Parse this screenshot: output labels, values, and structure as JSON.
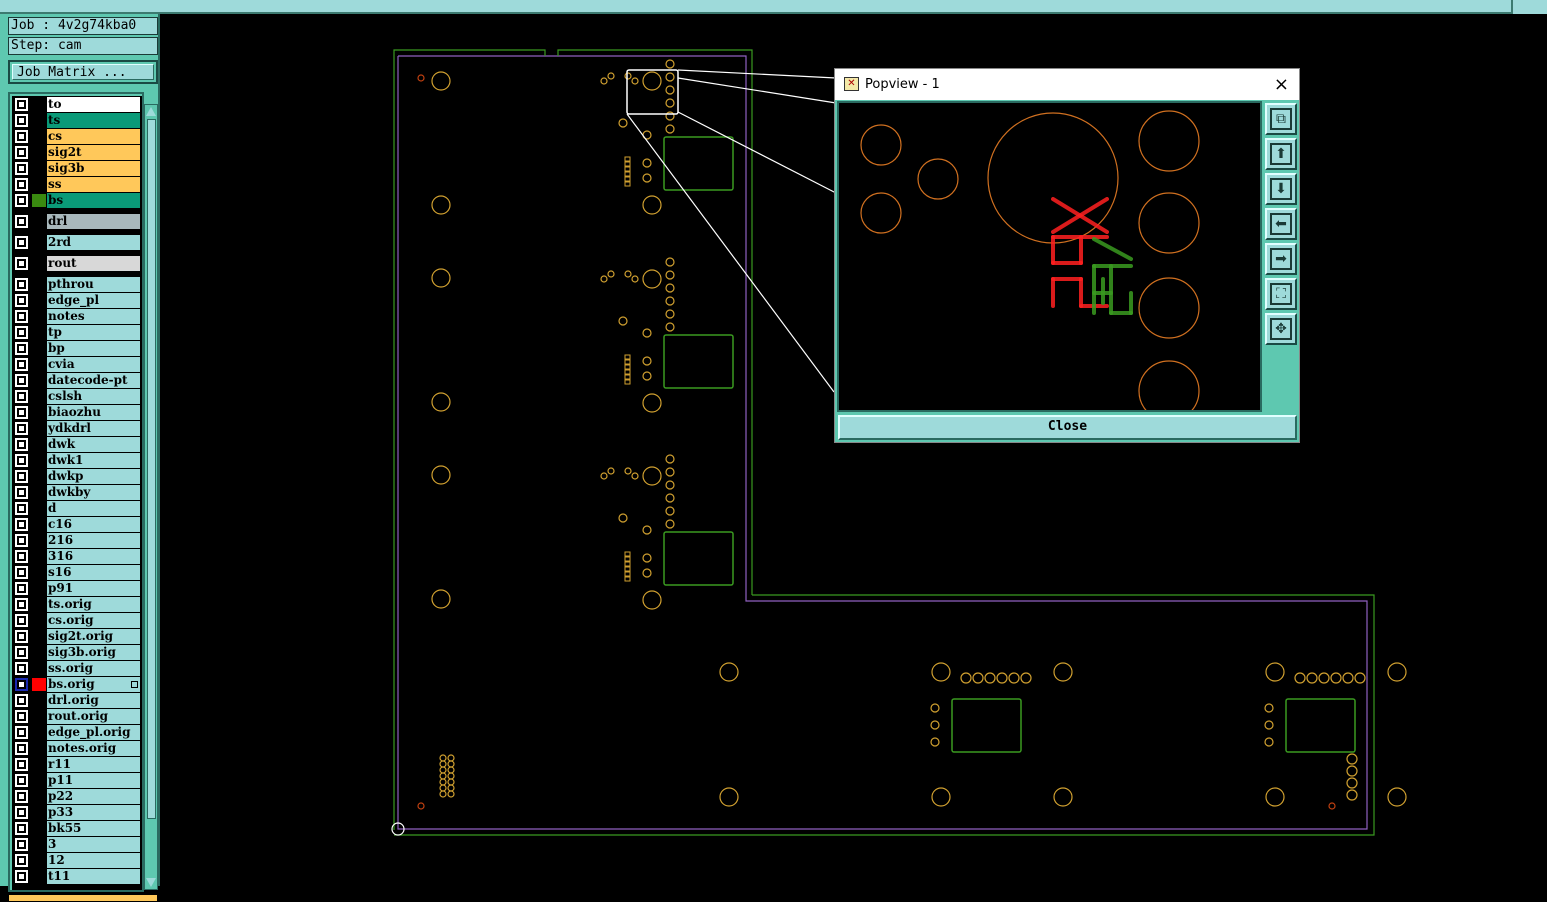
{
  "header": {
    "job_label": "Job : 4v2g74kba0",
    "step_label": "Step: cam",
    "job_matrix_button": "Job Matrix ..."
  },
  "layers": [
    {
      "name": "to",
      "color": "#ffffff"
    },
    {
      "name": "ts",
      "color": "#0a9a78"
    },
    {
      "name": "cs",
      "color": "#ffc85a"
    },
    {
      "name": "sig2t",
      "color": "#ffc85a"
    },
    {
      "name": "sig3b",
      "color": "#ffc85a"
    },
    {
      "name": "ss",
      "color": "#ffc85a"
    },
    {
      "name": "bs",
      "color": "#0a9a78",
      "display_color": "#3a8a10"
    },
    {
      "name": "drl",
      "color": "#a8b8bc"
    },
    {
      "name": "2rd",
      "color": "#9edada"
    },
    {
      "name": "rout",
      "color": "#d8d8d8"
    },
    {
      "name": "pthrou",
      "color": "#9edada"
    },
    {
      "name": "edge_pl",
      "color": "#9edada"
    },
    {
      "name": "notes",
      "color": "#9edada"
    },
    {
      "name": "tp",
      "color": "#9edada"
    },
    {
      "name": "bp",
      "color": "#9edada"
    },
    {
      "name": "cvia",
      "color": "#9edada"
    },
    {
      "name": "datecode-pt",
      "color": "#9edada"
    },
    {
      "name": "cslsh",
      "color": "#9edada"
    },
    {
      "name": "biaozhu",
      "color": "#9edada"
    },
    {
      "name": "ydkdrl",
      "color": "#9edada"
    },
    {
      "name": "dwk",
      "color": "#9edada"
    },
    {
      "name": "dwk1",
      "color": "#9edada"
    },
    {
      "name": "dwkp",
      "color": "#9edada"
    },
    {
      "name": "dwkby",
      "color": "#9edada"
    },
    {
      "name": "d",
      "color": "#9edada"
    },
    {
      "name": "c16",
      "color": "#9edada"
    },
    {
      "name": "216",
      "color": "#9edada"
    },
    {
      "name": "316",
      "color": "#9edada"
    },
    {
      "name": "s16",
      "color": "#9edada"
    },
    {
      "name": "p91",
      "color": "#9edada"
    },
    {
      "name": "ts.orig",
      "color": "#9edada"
    },
    {
      "name": "cs.orig",
      "color": "#9edada"
    },
    {
      "name": "sig2t.orig",
      "color": "#9edada"
    },
    {
      "name": "sig3b.orig",
      "color": "#9edada"
    },
    {
      "name": "ss.orig",
      "color": "#9edada"
    },
    {
      "name": "bs.orig",
      "color": "#9edada",
      "display_color": "#ff0000",
      "work": true
    },
    {
      "name": "drl.orig",
      "color": "#9edada"
    },
    {
      "name": "rout.orig",
      "color": "#9edada"
    },
    {
      "name": "edge_pl.orig",
      "color": "#9edada"
    },
    {
      "name": "notes.orig",
      "color": "#9edada"
    },
    {
      "name": "r11",
      "color": "#9edada"
    },
    {
      "name": "p11",
      "color": "#9edada"
    },
    {
      "name": "p22",
      "color": "#9edada"
    },
    {
      "name": "p33",
      "color": "#9edada"
    },
    {
      "name": "bk55",
      "color": "#9edada"
    },
    {
      "name": "3",
      "color": "#9edada"
    },
    {
      "name": "12",
      "color": "#9edada"
    },
    {
      "name": "t11",
      "color": "#9edada"
    }
  ],
  "popview": {
    "title": "Popview - 1",
    "close_label": "Close",
    "close_icon": "×",
    "tools": [
      "zoom-back-icon",
      "pan-up-icon",
      "pan-down-icon",
      "pan-left-icon",
      "pan-right-icon",
      "zoom-fit-icon",
      "pan-center-icon"
    ]
  },
  "colors": {
    "panel": "#5ec8b0",
    "field": "#9edada",
    "outline": "#3a9a20",
    "pad": "#d0a030",
    "drill": "#c04010",
    "silk": "#ff2020",
    "profile": "#9060c0"
  }
}
